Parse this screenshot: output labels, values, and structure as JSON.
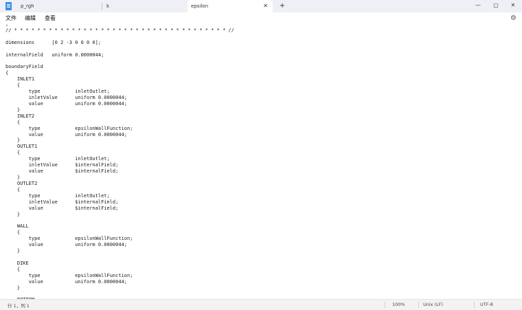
{
  "tabs": [
    {
      "label": "p_rgh",
      "active": false
    },
    {
      "label": "k",
      "active": false
    },
    {
      "label": "epsilon",
      "active": true
    }
  ],
  "tab_close_glyph": "✕",
  "new_tab_glyph": "+",
  "window_controls": {
    "minimize": "—",
    "maximize": "▢",
    "close": "✕"
  },
  "menu": {
    "file": "文件",
    "edit": "编辑",
    "view": "查看"
  },
  "settings_icon_glyph": "⚙",
  "editor": {
    "lines": [
      ",",
      "// * * * * * * * * * * * * * * * * * * * * * * * * * * * * * * * * * * * * * //",
      "",
      "dimensions      [0 2 -3 0 0 0 0];",
      "",
      "internalField   uniform 0.0000044;",
      "",
      "boundaryField",
      "{",
      "    INLET1",
      "    {",
      "        type            inletOutlet;",
      "        inletValue      uniform 0.0000044;",
      "        value           uniform 0.0000044;",
      "    }",
      "    INLET2",
      "    {",
      "        type            epsilonWallFunction;",
      "        value           uniform 0.0000044;",
      "    }",
      "    OUTLET1",
      "    {",
      "        type            inletOutlet;",
      "        inletValue      $internalField;",
      "        value           $internalField;",
      "    }",
      "    OUTLET2",
      "    {",
      "        type            inletOutlet;",
      "        inletValue      $internalField;",
      "        value           $internalField;",
      "    }",
      "",
      "    WALL",
      "    {",
      "        type            epsilonWallFunction;",
      "        value           uniform 0.0000044;",
      "    }",
      "",
      "    DIKE",
      "    {",
      "        type            epsilonWallFunction;",
      "        value           uniform 0.0000044;",
      "    }",
      "",
      "    BOTTOM"
    ]
  },
  "status": {
    "position": "行 1，列 1",
    "zoom": "100%",
    "line_ending": "Unix (LF)",
    "encoding": "UTF-8"
  }
}
